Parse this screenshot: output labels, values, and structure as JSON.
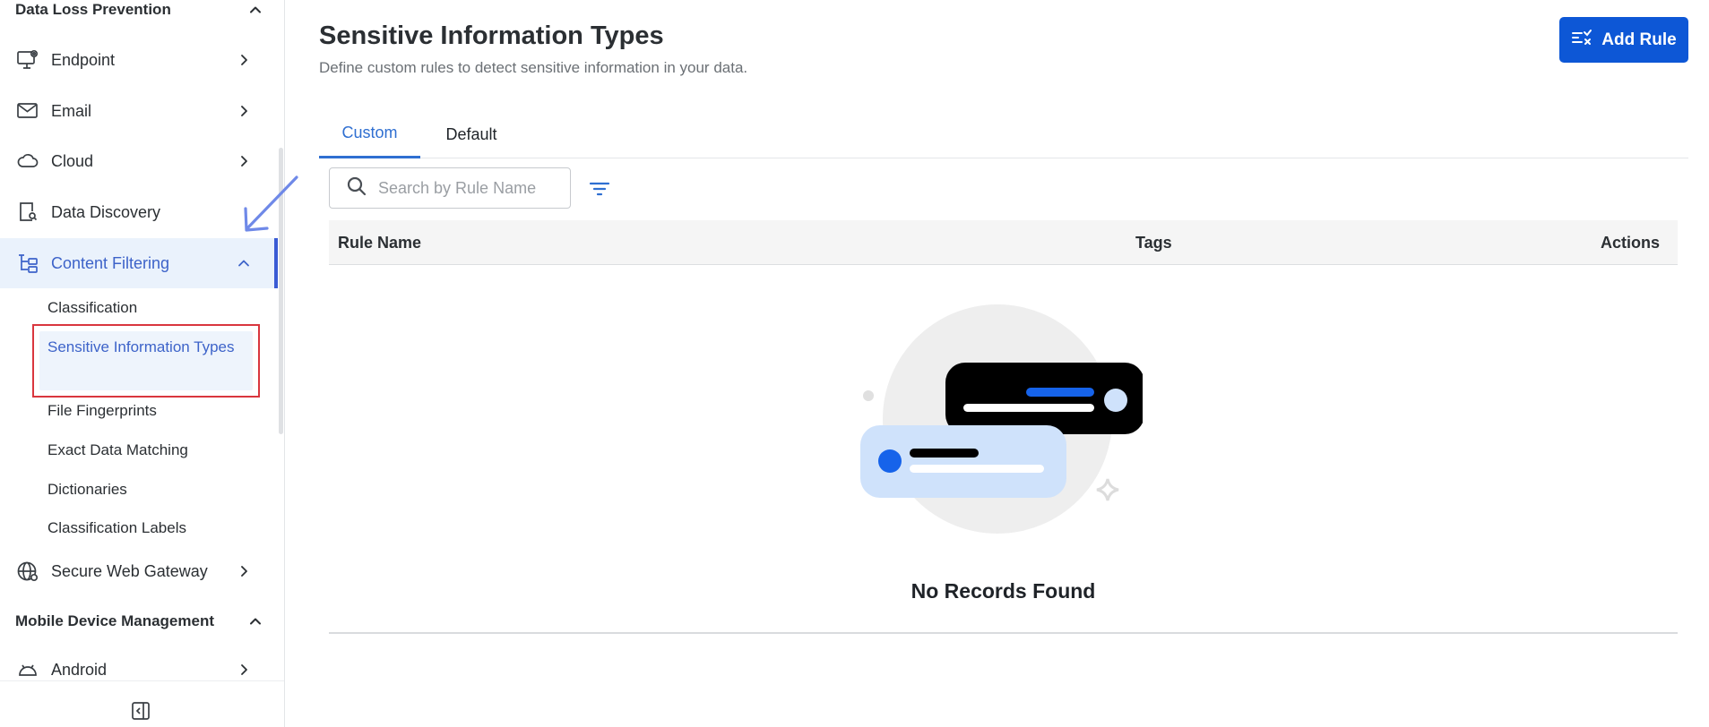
{
  "sidebar": {
    "section_dlp": "Data Loss Prevention",
    "items": [
      {
        "label": "Endpoint"
      },
      {
        "label": "Email"
      },
      {
        "label": "Cloud"
      },
      {
        "label": "Data Discovery"
      },
      {
        "label": "Content Filtering"
      }
    ],
    "sub_items": [
      {
        "label": "Classification"
      },
      {
        "label": "Sensitive Information Types"
      },
      {
        "label": "File Fingerprints"
      },
      {
        "label": "Exact Data Matching"
      },
      {
        "label": "Dictionaries"
      },
      {
        "label": "Classification Labels"
      }
    ],
    "secure_web_gateway": "Secure Web Gateway",
    "section_mdm": "Mobile Device Management",
    "android": "Android"
  },
  "main": {
    "title": "Sensitive Information Types",
    "subtitle": "Define custom rules to detect sensitive information in your data.",
    "add_rule_label": "Add Rule",
    "tabs": [
      {
        "label": "Custom",
        "active": true
      },
      {
        "label": "Default",
        "active": false
      }
    ],
    "search": {
      "placeholder": "Search by Rule Name",
      "value": ""
    },
    "table": {
      "columns": [
        "Rule Name",
        "Tags",
        "Actions"
      ]
    },
    "empty_message": "No Records Found"
  },
  "colors": {
    "accent": "#0d57d6",
    "active_nav": "#3d63c9",
    "highlight_border": "#d9363e"
  }
}
